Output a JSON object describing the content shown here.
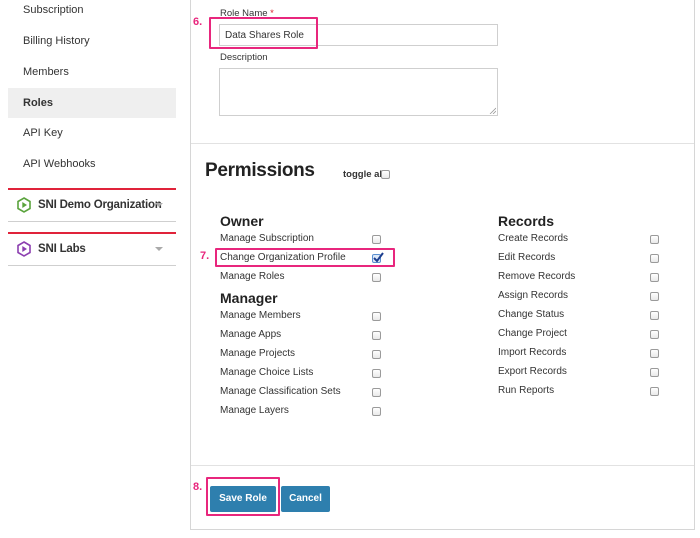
{
  "sidebar": {
    "items": [
      {
        "label": "Subscription",
        "active": false
      },
      {
        "label": "Billing History",
        "active": false
      },
      {
        "label": "Members",
        "active": false
      },
      {
        "label": "Roles",
        "active": true
      },
      {
        "label": "API Key",
        "active": false
      },
      {
        "label": "API Webhooks",
        "active": false
      }
    ],
    "orgs": [
      {
        "name": "SNI Demo Organization",
        "icon": "green-play-hexagon-icon",
        "icon_color": "#5aa33c"
      },
      {
        "name": "SNI Labs",
        "icon": "purple-play-hexagon-icon",
        "icon_color": "#8c3fb0"
      }
    ]
  },
  "form": {
    "role_name_label": "Role Name",
    "required_mark": "*",
    "role_name_value": "Data Shares Role",
    "description_label": "Description",
    "description_value": ""
  },
  "permissions": {
    "title": "Permissions",
    "toggle_all_label": "toggle all",
    "toggle_all_checked": false,
    "groups": [
      {
        "title": "Owner",
        "items": [
          {
            "label": "Manage Subscription",
            "checked": false
          },
          {
            "label": "Change Organization Profile",
            "checked": true
          },
          {
            "label": "Manage Roles",
            "checked": false
          }
        ]
      },
      {
        "title": "Manager",
        "items": [
          {
            "label": "Manage Members",
            "checked": false
          },
          {
            "label": "Manage Apps",
            "checked": false
          },
          {
            "label": "Manage Projects",
            "checked": false
          },
          {
            "label": "Manage Choice Lists",
            "checked": false
          },
          {
            "label": "Manage Classification Sets",
            "checked": false
          },
          {
            "label": "Manage Layers",
            "checked": false
          }
        ]
      },
      {
        "title": "Records",
        "items": [
          {
            "label": "Create Records",
            "checked": false
          },
          {
            "label": "Edit Records",
            "checked": false
          },
          {
            "label": "Remove Records",
            "checked": false
          },
          {
            "label": "Assign Records",
            "checked": false
          },
          {
            "label": "Change Status",
            "checked": false
          },
          {
            "label": "Change Project",
            "checked": false
          },
          {
            "label": "Import Records",
            "checked": false
          },
          {
            "label": "Export Records",
            "checked": false
          },
          {
            "label": "Run Reports",
            "checked": false
          }
        ]
      }
    ]
  },
  "actions": {
    "save_label": "Save Role",
    "cancel_label": "Cancel"
  },
  "annotations": {
    "step6": "6.",
    "step7": "7.",
    "step8": "8.",
    "color": "#e8267d"
  },
  "colors": {
    "primary_button": "#2e7fae",
    "org_separator": "#e0233a"
  }
}
